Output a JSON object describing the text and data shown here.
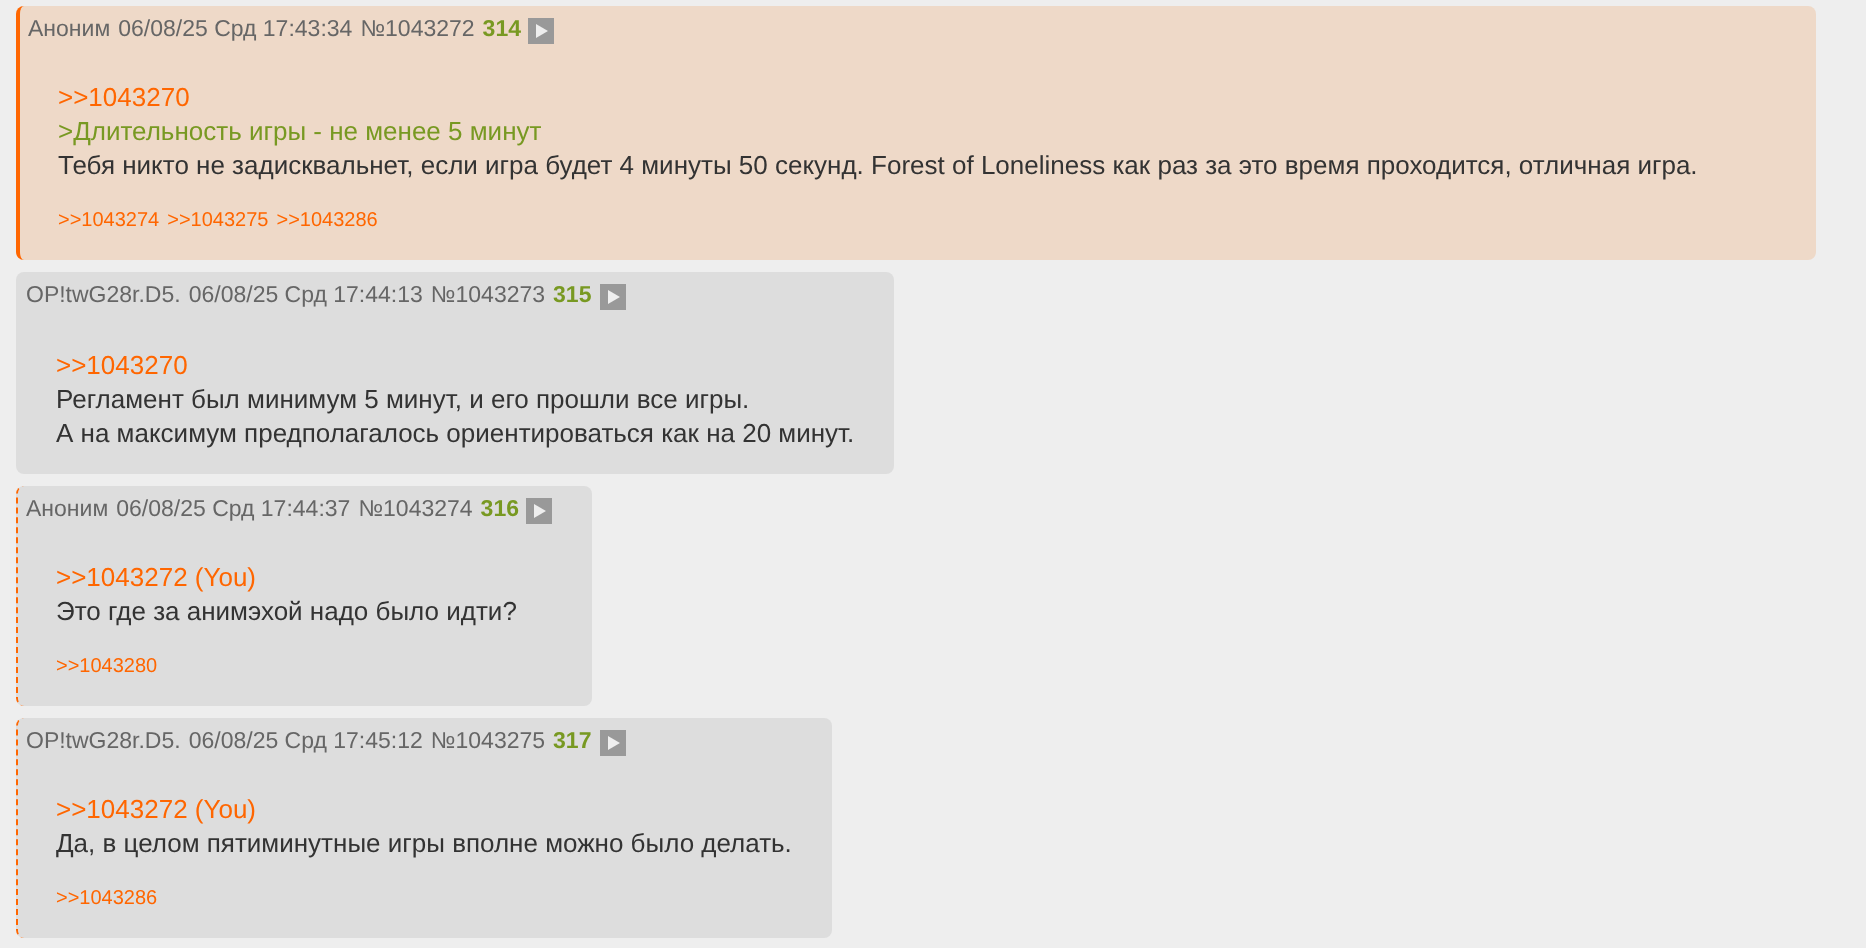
{
  "posts": [
    {
      "name": "Аноним",
      "date": "06/08/25 Срд 17:43:34",
      "number": "№1043272",
      "index": "314",
      "highlighted": true,
      "body": [
        {
          "kind": "link",
          "text": ">>1043270"
        },
        {
          "kind": "quote",
          "text": ">Длительность игры - не менее 5 минут"
        },
        {
          "kind": "text",
          "text": "Тебя никто не задисквальнет, если игра будет 4 минуты 50 секунд. Forest of Loneliness как раз за это время проходится, отличная игра."
        }
      ],
      "replies": [
        ">>1043274",
        ">>1043275",
        ">>1043286"
      ]
    },
    {
      "name": "OP!twG28r.D5.",
      "date": "06/08/25 Срд 17:44:13",
      "number": "№1043273",
      "index": "315",
      "highlighted": false,
      "reply_to_you": false,
      "body": [
        {
          "kind": "link",
          "text": ">>1043270"
        },
        {
          "kind": "text",
          "text": "Регламент был минимум 5 минут, и его прошли все игры."
        },
        {
          "kind": "text",
          "text": "А на максимум предполагалось ориентироваться как на 20 минут."
        }
      ]
    },
    {
      "name": "Аноним",
      "date": "06/08/25 Срд 17:44:37",
      "number": "№1043274",
      "index": "316",
      "highlighted": false,
      "reply_to_you": true,
      "body": [
        {
          "kind": "link",
          "text": ">>1043272 (You)"
        },
        {
          "kind": "text",
          "text": "Это где за анимэхой надо было идти?"
        }
      ],
      "replies": [
        ">>1043280"
      ]
    },
    {
      "name": "OP!twG28r.D5.",
      "date": "06/08/25 Срд 17:45:12",
      "number": "№1043275",
      "index": "317",
      "highlighted": false,
      "reply_to_you": true,
      "body": [
        {
          "kind": "link",
          "text": ">>1043272 (You)"
        },
        {
          "kind": "text",
          "text": "Да, в целом пятиминутные игры вполне можно было делать."
        }
      ],
      "replies": [
        ">>1043286"
      ]
    }
  ]
}
